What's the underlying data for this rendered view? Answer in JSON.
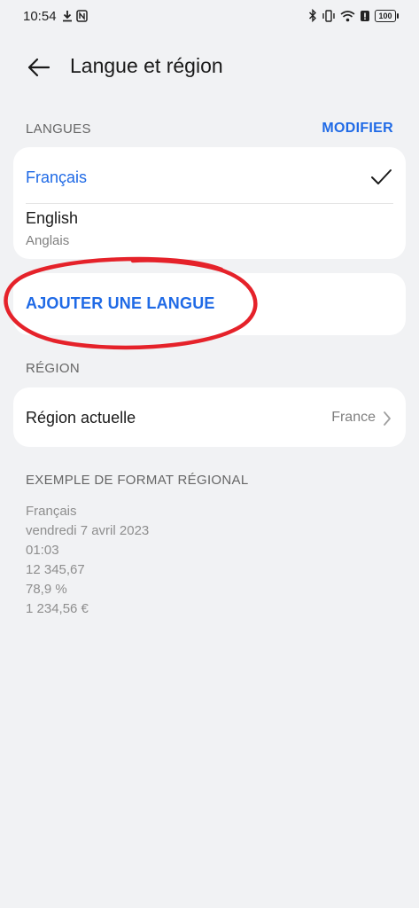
{
  "status_bar": {
    "time": "10:54",
    "battery": "100"
  },
  "header": {
    "title": "Langue et région"
  },
  "languages": {
    "section_label": "LANGUES",
    "modify_label": "MODIFIER",
    "items": [
      {
        "label": "Français",
        "selected": true
      },
      {
        "label": "English",
        "sublabel": "Anglais",
        "selected": false
      }
    ],
    "add_label": "AJOUTER UNE LANGUE"
  },
  "region": {
    "section_label": "RÉGION",
    "current_label": "Région actuelle",
    "current_value": "France"
  },
  "example": {
    "title": "EXEMPLE DE FORMAT RÉGIONAL",
    "lines": [
      "Français",
      "vendredi 7 avril 2023",
      "01:03",
      "12 345,67",
      "78,9 %",
      "1 234,56 €"
    ]
  },
  "colors": {
    "accent": "#1f6ae6",
    "annotation": "#e5222a",
    "background": "#f1f2f4"
  },
  "icons": [
    "download-icon",
    "nfc-icon",
    "bluetooth-icon",
    "vibrate-icon",
    "wifi-icon",
    "alert-icon",
    "battery-icon",
    "back-arrow-icon",
    "check-icon",
    "chevron-right-icon"
  ]
}
